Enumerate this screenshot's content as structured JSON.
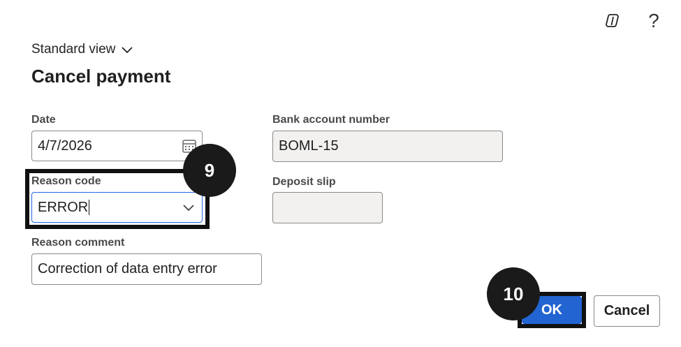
{
  "header": {
    "copilot_icon": "copilot-icon",
    "help_label": "?"
  },
  "view_selector": {
    "label": "Standard view"
  },
  "title": "Cancel payment",
  "form": {
    "date": {
      "label": "Date",
      "value": "4/7/2026"
    },
    "reason_code": {
      "label": "Reason code",
      "value": "ERROR"
    },
    "reason_comment": {
      "label": "Reason comment",
      "value": "Correction of data entry error"
    },
    "bank_account_number": {
      "label": "Bank account number",
      "value": "BOML-15"
    },
    "deposit_slip": {
      "label": "Deposit slip",
      "value": ""
    }
  },
  "annotations": {
    "step_reason_code": "9",
    "step_ok": "10"
  },
  "buttons": {
    "ok_label": "OK",
    "cancel_label": "Cancel"
  },
  "colors": {
    "primary": "#2264d1",
    "focus_border": "#2266e3",
    "badge": "#1a1a1a",
    "readonly_bg": "#f2f1f0"
  }
}
